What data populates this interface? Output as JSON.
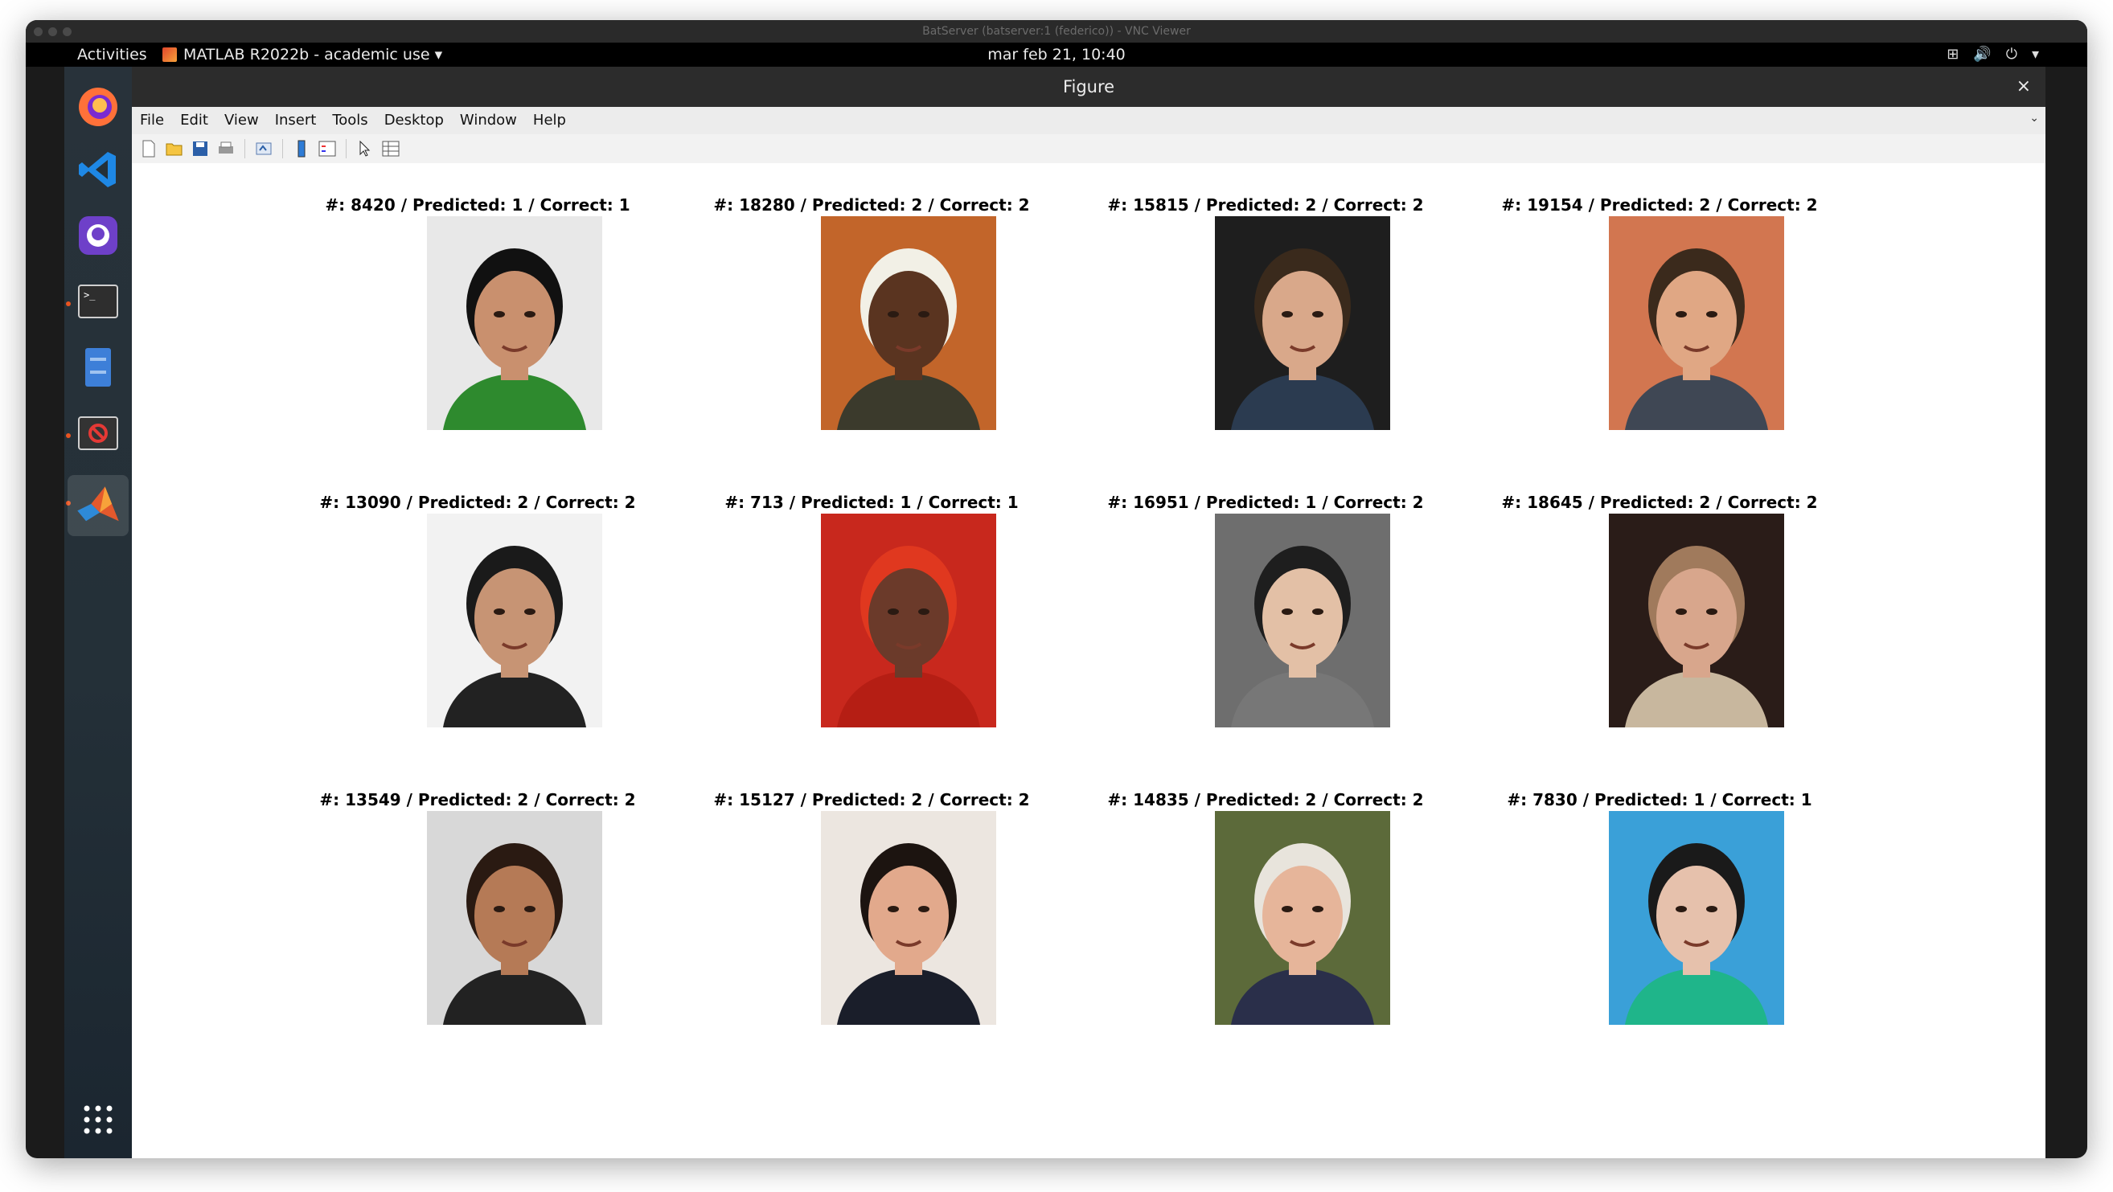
{
  "vnc": {
    "title": "BatServer (batserver:1 (federico)) - VNC Viewer"
  },
  "topbar": {
    "activities": "Activities",
    "app_menu": "MATLAB R2022b - academic use ▾",
    "clock": "mar feb 21, 10:40"
  },
  "dock": {
    "items": [
      "firefox-icon",
      "vscode-icon",
      "github-desktop-icon",
      "terminal-icon",
      "files-icon",
      "blocked-app-icon",
      "matlab-icon",
      "app-grid-icon"
    ]
  },
  "figure_window": {
    "title": "Figure",
    "close": "×",
    "menu": [
      "File",
      "Edit",
      "View",
      "Insert",
      "Tools",
      "Desktop",
      "Window",
      "Help"
    ]
  },
  "results": [
    {
      "label": "#: 8420 / Predicted: 1 / Correct: 1",
      "bg": "#e8e8e8",
      "skin": "#c9906e",
      "hair": "#111111",
      "cloth": "#2e8a2e"
    },
    {
      "label": "#: 18280 / Predicted: 2 / Correct: 2",
      "bg": "#c2652a",
      "skin": "#5a3420",
      "hair": "#f2f0e6",
      "cloth": "#3b3a2c"
    },
    {
      "label": "#: 15815 / Predicted: 2 / Correct: 2",
      "bg": "#1e1e1e",
      "skin": "#d9a88a",
      "hair": "#3a2a1c",
      "cloth": "#2b3b50"
    },
    {
      "label": "#: 19154 / Predicted: 2 / Correct: 2",
      "bg": "#d27650",
      "skin": "#e0a784",
      "hair": "#3b2a1c",
      "cloth": "#3f4754"
    },
    {
      "label": "#: 13090 / Predicted: 2 / Correct: 2",
      "bg": "#f2f2f2",
      "skin": "#c79474",
      "hair": "#1a1a1a",
      "cloth": "#222222"
    },
    {
      "label": "#: 713 / Predicted: 1 / Correct: 1",
      "bg": "#c8281d",
      "skin": "#6b3a2a",
      "hair": "#e0381f",
      "cloth": "#b51e14"
    },
    {
      "label": "#: 16951 / Predicted: 1 / Correct: 2",
      "bg": "#6e6e6e",
      "skin": "#e3c0a6",
      "hair": "#1e1e1e",
      "cloth": "#777777"
    },
    {
      "label": "#: 18645 / Predicted: 2 / Correct: 2",
      "bg": "#2a1c18",
      "skin": "#d8a68c",
      "hair": "#a07a5c",
      "cloth": "#c8b79e"
    },
    {
      "label": "#: 13549 / Predicted: 2 / Correct: 2",
      "bg": "#d8d8d8",
      "skin": "#b57a56",
      "hair": "#2a1a12",
      "cloth": "#222222"
    },
    {
      "label": "#: 15127 / Predicted: 2 / Correct: 2",
      "bg": "#ece6e0",
      "skin": "#e2a98c",
      "hair": "#1c1410",
      "cloth": "#1a1e2a"
    },
    {
      "label": "#: 14835 / Predicted: 2 / Correct: 2",
      "bg": "#5c6a3a",
      "skin": "#e6b59a",
      "hair": "#e8e4dc",
      "cloth": "#2a2f4a"
    },
    {
      "label": "#: 7830 / Predicted: 1 / Correct: 1",
      "bg": "#3aa0d8",
      "skin": "#e6c1ac",
      "hair": "#1a1a1a",
      "cloth": "#1fb58a"
    }
  ]
}
